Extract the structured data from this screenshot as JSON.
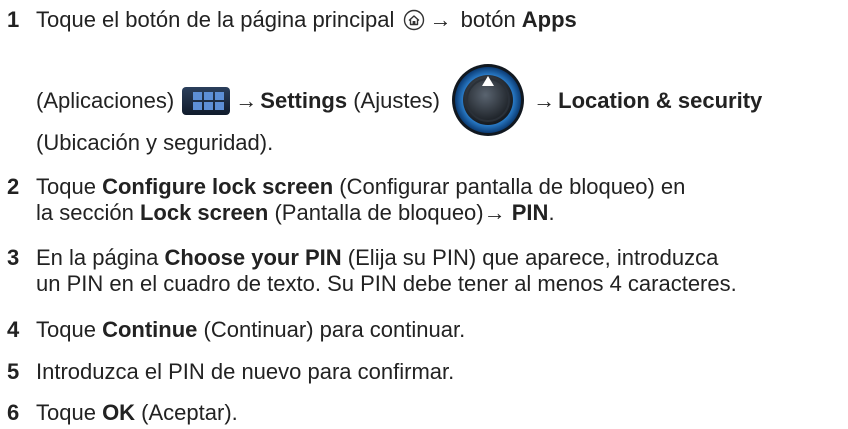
{
  "steps": [
    {
      "number": "1",
      "line1": {
        "pre": "Toque el botón de la página principal",
        "arrow": "→",
        "mid": " botón ",
        "bold": "Apps"
      },
      "line2": {
        "pre": "(Aplicaciones)",
        "arrow1": "→",
        "bold1": "Settings",
        "mid": " (Ajustes)",
        "arrow2": "→",
        "bold2": "Location & security"
      },
      "line3": "(Ubicación y seguridad)."
    },
    {
      "number": "2",
      "line1": {
        "pre": "Toque ",
        "bold": "Configure lock screen",
        "post": " (Configurar pantalla de bloqueo) en"
      },
      "line2": {
        "pre": "la sección ",
        "bold1": "Lock screen",
        "mid": " (Pantalla de bloqueo)",
        "arrow": "→",
        "space": " ",
        "bold2": "PIN",
        "post": "."
      }
    },
    {
      "number": "3",
      "line1": {
        "pre": "En la página ",
        "bold": "Choose your PIN",
        "post": " (Elija su PIN) que aparece, introduzca"
      },
      "line2": "un PIN en el cuadro de texto. Su PIN debe tener al menos 4 caracteres."
    },
    {
      "number": "4",
      "line1": {
        "pre": "Toque ",
        "bold": "Continue",
        "post": " (Continuar) para continuar."
      }
    },
    {
      "number": "5",
      "line1": "Introduzca el PIN de nuevo para confirmar."
    },
    {
      "number": "6",
      "line1": {
        "pre": "Toque ",
        "bold": "OK",
        "post": " (Aceptar)."
      }
    }
  ],
  "icons": {
    "home": "home-icon",
    "apps": "apps-grid-icon",
    "settings": "settings-orb-icon"
  },
  "colors": {
    "text": "#222222",
    "apps_bg": "#1c2b40",
    "apps_squares": "#5d8fd6",
    "settings_glow": "#3da5ff"
  }
}
